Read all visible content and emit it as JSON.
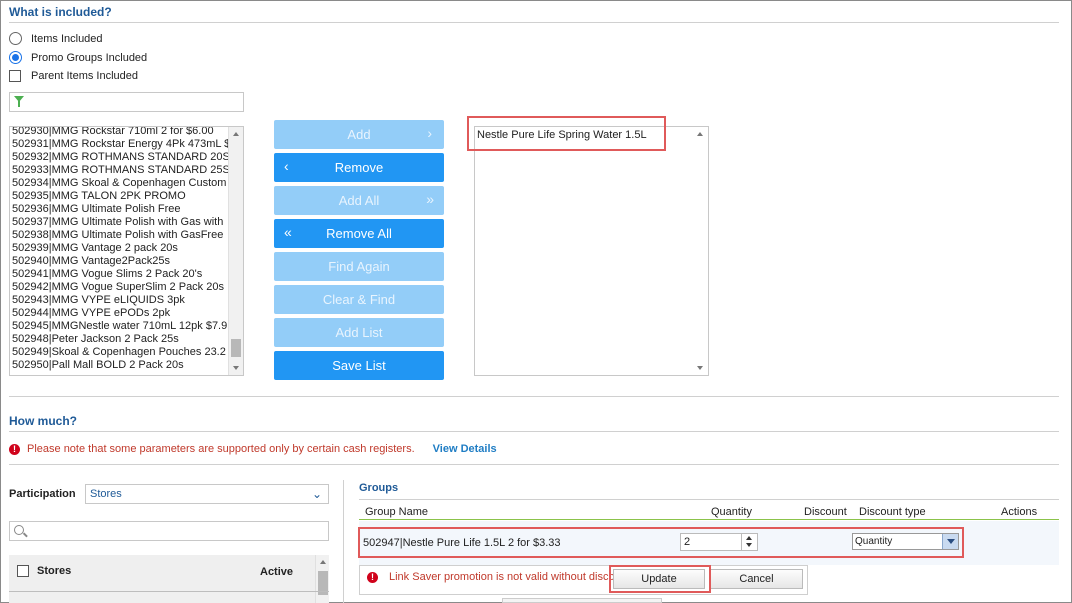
{
  "included_section": {
    "title": "What is included?",
    "options": [
      {
        "label": "Items Included",
        "selected": false
      },
      {
        "label": "Promo Groups Included",
        "selected": true
      }
    ],
    "parent_items_label": "Parent Items Included",
    "filter_value": "",
    "available_list": [
      "502930|MMG Rockstar 710ml 2 for $6.00",
      "502931|MMG Rockstar Energy 4Pk 473mL $",
      "502932|MMG ROTHMANS STANDARD 20S",
      "502933|MMG ROTHMANS STANDARD 25S",
      "502934|MMG Skoal & Copenhagen Custom",
      "502935|MMG TALON 2PK PROMO",
      "502936|MMG Ultimate Polish Free",
      "502937|MMG Ultimate Polish with Gas with",
      "502938|MMG Ultimate Polish with GasFree",
      "502939|MMG Vantage 2 pack 20s",
      "502940|MMG Vantage2Pack25s",
      "502941|MMG Vogue Slims 2 Pack 20's",
      "502942|MMG Vogue SuperSlim 2 Pack 20s",
      "502943|MMG VYPE eLIQUIDS 3pk",
      "502944|MMG VYPE ePODs 2pk",
      "502945|MMGNestle water 710mL 12pk $7.9",
      "502948|Peter Jackson 2 Pack 25s",
      "502949|Skoal & Copenhagen Pouches 23.2",
      "502950|Pall Mall BOLD 2 Pack 20s"
    ],
    "buttons": {
      "add": "Add",
      "remove": "Remove",
      "add_all": "Add All",
      "remove_all": "Remove All",
      "find_again": "Find Again",
      "clear_find": "Clear & Find",
      "add_list": "Add List",
      "save_list": "Save List"
    },
    "selected_list": [
      "Nestle Pure Life Spring Water 1.5L"
    ]
  },
  "how_much_section": {
    "title": "How much?",
    "warning": "Please note that some parameters are supported only by certain cash registers.",
    "view_details": "View Details",
    "participation_label": "Participation",
    "participation_value": "Stores",
    "search_placeholder": "",
    "stores_table": {
      "col_stores": "Stores",
      "col_active": "Active"
    }
  },
  "groups": {
    "title": "Groups",
    "columns": {
      "group_name": "Group Name",
      "quantity": "Quantity",
      "discount": "Discount",
      "discount_type": "Discount type",
      "actions": "Actions"
    },
    "row": {
      "group_name": "502947|Nestle Pure Life 1.5L 2 for $3.33",
      "quantity": "2",
      "discount_type": "Quantity"
    },
    "validation": "Link Saver promotion is not valid without disco",
    "update_label": "Update",
    "cancel_label": "Cancel"
  },
  "colors": {
    "accent": "#2196f3",
    "accent_disabled": "#93cdf8",
    "title": "#1f5a97",
    "error": "#d0021b",
    "highlight_box": "#e05a5a"
  }
}
